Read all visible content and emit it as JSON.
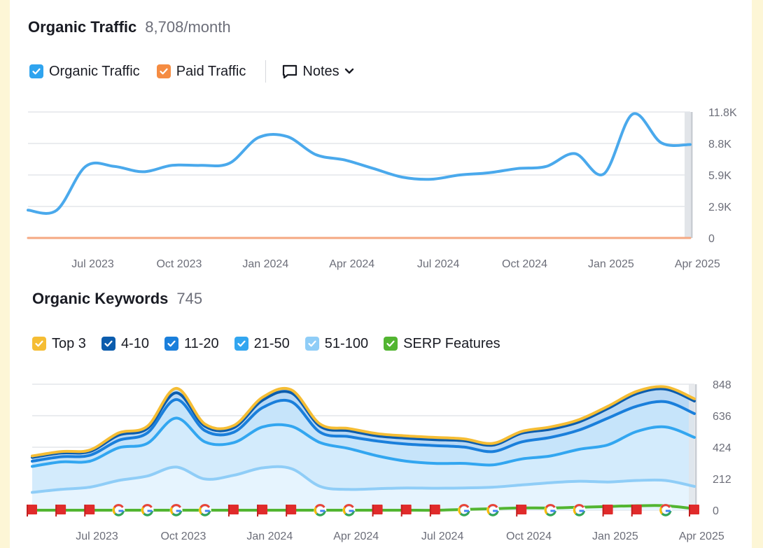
{
  "traffic_panel": {
    "title": "Organic Traffic",
    "metric": "8,708/month",
    "legend": [
      {
        "label": "Organic Traffic",
        "color": "#2fa4ef",
        "checked": true
      },
      {
        "label": "Paid Traffic",
        "color": "#f58c42",
        "checked": true
      }
    ],
    "notes_label": "Notes"
  },
  "keywords_panel": {
    "title": "Organic Keywords",
    "metric": "745",
    "legend": [
      {
        "label": "Top 3",
        "color": "#f5bd34",
        "checked": true
      },
      {
        "label": "4-10",
        "color": "#0b5cad",
        "checked": true
      },
      {
        "label": "11-20",
        "color": "#1a7fdb",
        "checked": true
      },
      {
        "label": "21-50",
        "color": "#32a6f0",
        "checked": true
      },
      {
        "label": "51-100",
        "color": "#8fcdf7",
        "checked": true
      },
      {
        "label": "SERP Features",
        "color": "#52b531",
        "checked": true
      }
    ]
  },
  "chart_data": [
    {
      "type": "line",
      "title": "Organic Traffic",
      "x_ticks": [
        "Jul 2023",
        "Oct 2023",
        "Jan 2024",
        "Apr 2024",
        "Jul 2024",
        "Oct 2024",
        "Jan 2025",
        "Apr 2025"
      ],
      "x_tick_index": [
        2.25,
        5.25,
        8.25,
        11.25,
        14.25,
        17.25,
        20.25,
        23.25
      ],
      "y_ticks": [
        "0",
        "2.9K",
        "5.9K",
        "8.8K",
        "11.8K"
      ],
      "ylim": [
        0,
        11800
      ],
      "x_count": 24,
      "series": [
        {
          "name": "Organic Traffic",
          "color": "#4aa9ec",
          "values": [
            2600,
            2600,
            6700,
            6700,
            6200,
            6800,
            6800,
            7000,
            9400,
            9500,
            7800,
            7300,
            6500,
            5700,
            5500,
            5900,
            6100,
            6500,
            6700,
            7900,
            6000,
            11600,
            8900,
            8750
          ]
        },
        {
          "name": "Paid Traffic",
          "color": "#f5a882",
          "values": [
            0,
            0,
            0,
            0,
            0,
            0,
            0,
            0,
            0,
            0,
            0,
            0,
            0,
            0,
            0,
            0,
            0,
            0,
            0,
            0,
            0,
            0,
            0,
            0
          ]
        }
      ]
    },
    {
      "type": "area",
      "title": "Organic Keywords",
      "x_ticks": [
        "Jul 2023",
        "Oct 2023",
        "Jan 2024",
        "Apr 2024",
        "Jul 2024",
        "Oct 2024",
        "Jan 2025",
        "Apr 2025"
      ],
      "x_tick_index": [
        2.25,
        5.25,
        8.25,
        11.25,
        14.25,
        17.25,
        20.25,
        23.25
      ],
      "y_ticks": [
        "0",
        "212",
        "424",
        "636",
        "848"
      ],
      "ylim": [
        0,
        848
      ],
      "x_count": 24,
      "series": [
        {
          "name": "Top 3",
          "color": "#f5bd34",
          "values": [
            365,
            395,
            405,
            520,
            565,
            820,
            580,
            570,
            760,
            810,
            580,
            550,
            515,
            500,
            490,
            480,
            450,
            530,
            560,
            610,
            700,
            800,
            830,
            750
          ]
        },
        {
          "name": "4-10",
          "color": "#0b5cad",
          "values": [
            355,
            385,
            395,
            505,
            550,
            790,
            565,
            555,
            740,
            790,
            565,
            535,
            500,
            485,
            475,
            468,
            438,
            518,
            545,
            595,
            685,
            785,
            815,
            735
          ]
        },
        {
          "name": "11-20",
          "color": "#1a7fdb",
          "values": [
            330,
            360,
            370,
            470,
            520,
            745,
            535,
            525,
            690,
            730,
            525,
            495,
            465,
            445,
            435,
            425,
            395,
            460,
            490,
            540,
            620,
            700,
            730,
            650
          ]
        },
        {
          "name": "21-50",
          "color": "#32a6f0",
          "values": [
            295,
            325,
            330,
            420,
            450,
            620,
            460,
            455,
            560,
            565,
            455,
            415,
            365,
            330,
            315,
            315,
            305,
            345,
            365,
            410,
            440,
            530,
            560,
            490
          ]
        },
        {
          "name": "51-100",
          "color": "#8fcdf7",
          "values": [
            120,
            140,
            155,
            200,
            230,
            290,
            210,
            235,
            285,
            280,
            160,
            140,
            145,
            150,
            148,
            150,
            155,
            170,
            185,
            195,
            190,
            200,
            200,
            160
          ]
        },
        {
          "name": "SERP Features",
          "color": "#52b531",
          "values": [
            0,
            0,
            0,
            0,
            0,
            0,
            0,
            0,
            0,
            0,
            0,
            0,
            0,
            0,
            0,
            5,
            10,
            15,
            15,
            20,
            25,
            30,
            30,
            10
          ]
        }
      ],
      "event_markers": [
        "flag",
        "flag",
        "flag",
        "G",
        "G",
        "G",
        "G",
        "flag",
        "flag",
        "flag",
        "G",
        "G",
        "flag",
        "flag",
        "flag",
        "G",
        "G",
        "flag",
        "G",
        "G",
        "flag",
        "flag",
        "G",
        "flag"
      ]
    }
  ]
}
